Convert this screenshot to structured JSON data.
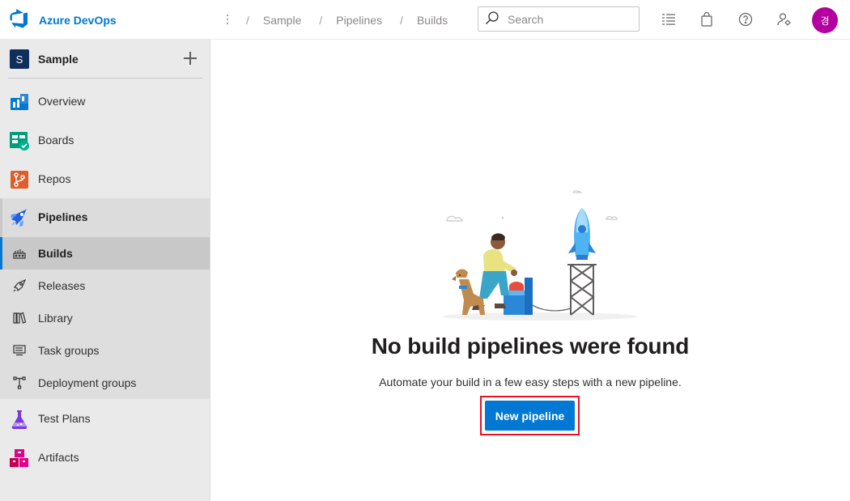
{
  "app": {
    "brand_name": "Azure DevOps",
    "accent_color": "#0078d4"
  },
  "header": {
    "more_icon": "more-vertical-icon",
    "breadcrumbs": [
      "Sample",
      "Pipelines",
      "Builds"
    ],
    "search": {
      "placeholder": "Search",
      "value": ""
    },
    "icons": [
      "task-list-icon",
      "shopping-bag-icon",
      "help-icon",
      "user-settings-icon"
    ],
    "avatar_initial": "경",
    "avatar_color": "#b4009e"
  },
  "sidebar": {
    "project_initial": "S",
    "project_name": "Sample",
    "nav": [
      {
        "label": "Overview",
        "icon": "overview-icon"
      },
      {
        "label": "Boards",
        "icon": "boards-icon"
      },
      {
        "label": "Repos",
        "icon": "repos-icon"
      },
      {
        "label": "Pipelines",
        "icon": "pipelines-icon",
        "active": true
      },
      {
        "label": "Test Plans",
        "icon": "test-plans-icon"
      },
      {
        "label": "Artifacts",
        "icon": "artifacts-icon"
      }
    ],
    "pipelines_sub": [
      {
        "label": "Builds",
        "icon": "builds-icon",
        "selected": true
      },
      {
        "label": "Releases",
        "icon": "releases-icon"
      },
      {
        "label": "Library",
        "icon": "library-icon"
      },
      {
        "label": "Task groups",
        "icon": "task-groups-icon"
      },
      {
        "label": "Deployment groups",
        "icon": "deployment-groups-icon"
      }
    ]
  },
  "main": {
    "empty_title": "No build pipelines were found",
    "empty_description": "Automate your build in a few easy steps with a new pipeline.",
    "primary_button": "New pipeline",
    "highlight_color": "#e81123"
  }
}
